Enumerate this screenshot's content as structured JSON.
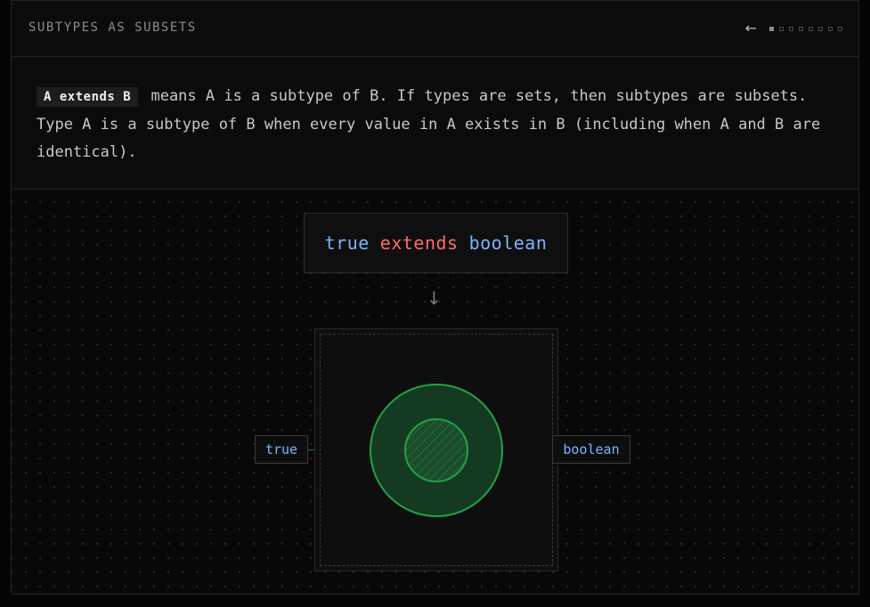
{
  "header": {
    "title": "SUBTYPES AS SUBSETS",
    "back_icon": "arrow-left-icon",
    "pagination": {
      "total": 8,
      "current": 1
    }
  },
  "description": {
    "code": "A extends B",
    "text": "means A is a subtype of B. If types are sets, then subtypes are subsets. Type A is a subtype of B when every value in A exists in B (including when A and B are identical)."
  },
  "expression": {
    "subtype": "true",
    "keyword": "extends",
    "supertype": "boolean"
  },
  "flow_icon": "arrow-down-icon",
  "venn": {
    "inner_label": "true",
    "outer_label": "boolean",
    "colors": {
      "outer_fill": "#143a22",
      "stroke": "#24a148",
      "inner_fill": "#1b4d2c"
    }
  },
  "colors": {
    "type_name": "#7cb2ff",
    "keyword": "#ff6b6b",
    "background": "#0a0a0a"
  }
}
